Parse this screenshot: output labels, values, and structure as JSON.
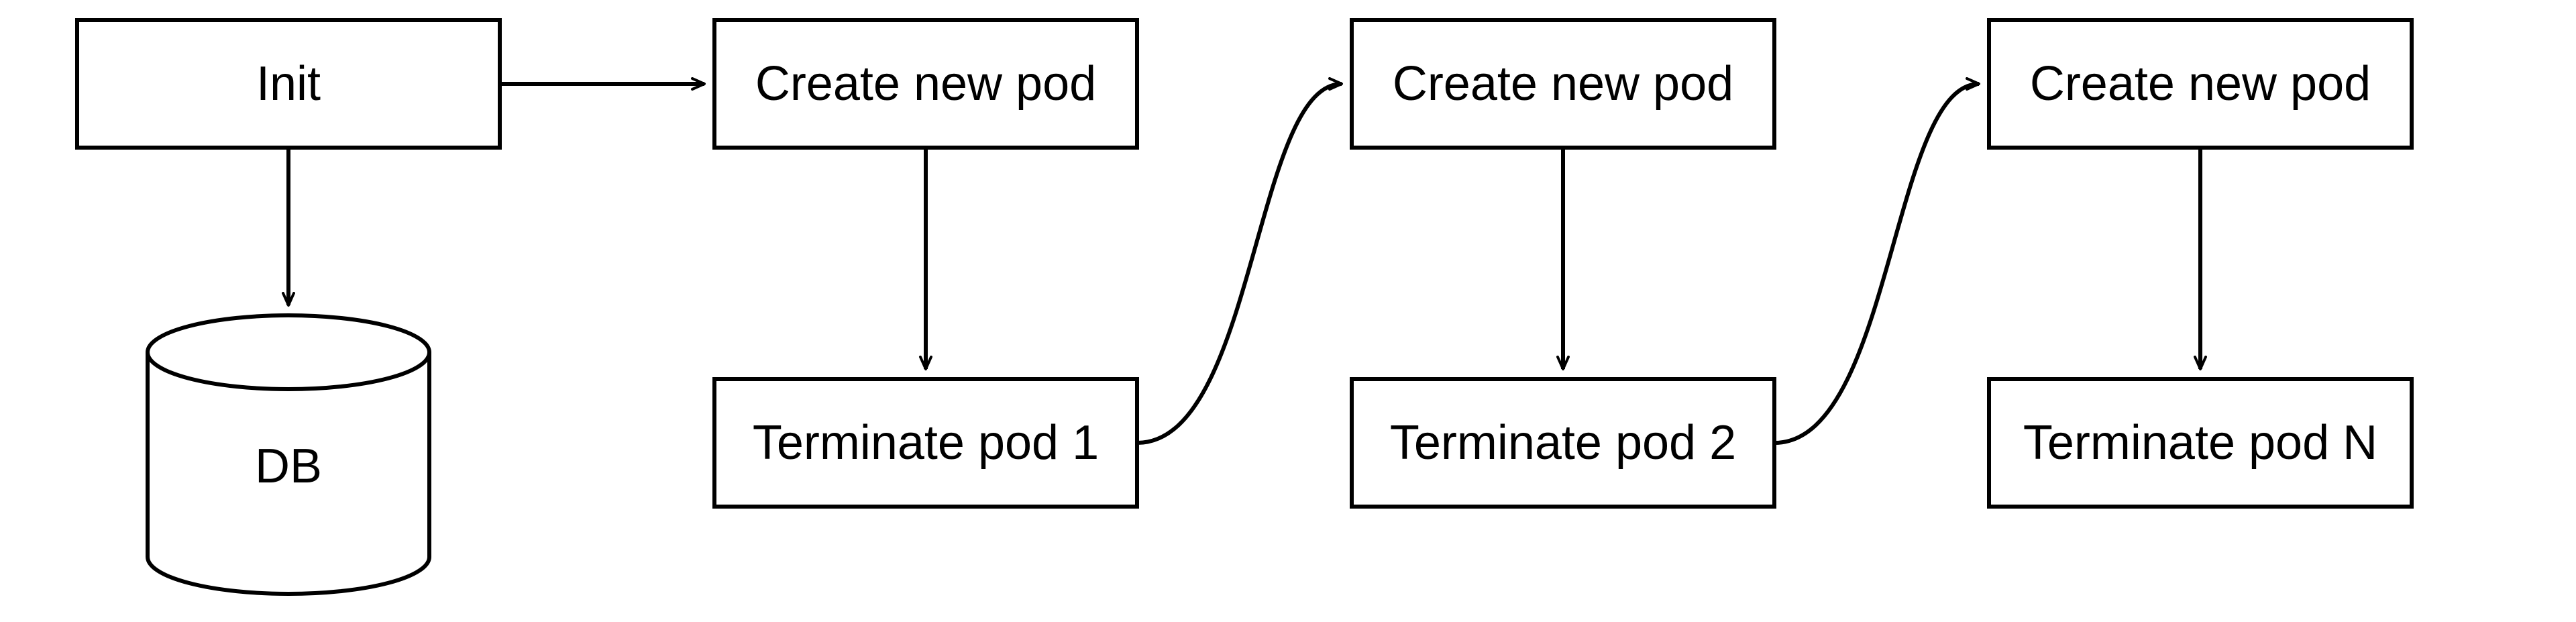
{
  "nodes": {
    "init": "Init",
    "db": "DB",
    "create1": "Create new pod",
    "terminate1": "Terminate pod 1",
    "create2": "Create new pod",
    "terminate2": "Terminate pod 2",
    "create3": "Create new pod",
    "terminate3": "Terminate pod N"
  },
  "flow": [
    {
      "from": "init",
      "to": "db"
    },
    {
      "from": "init",
      "to": "create1"
    },
    {
      "from": "create1",
      "to": "terminate1"
    },
    {
      "from": "terminate1",
      "to": "create2"
    },
    {
      "from": "create2",
      "to": "terminate2"
    },
    {
      "from": "terminate2",
      "to": "create3"
    },
    {
      "from": "create3",
      "to": "terminate3"
    }
  ]
}
